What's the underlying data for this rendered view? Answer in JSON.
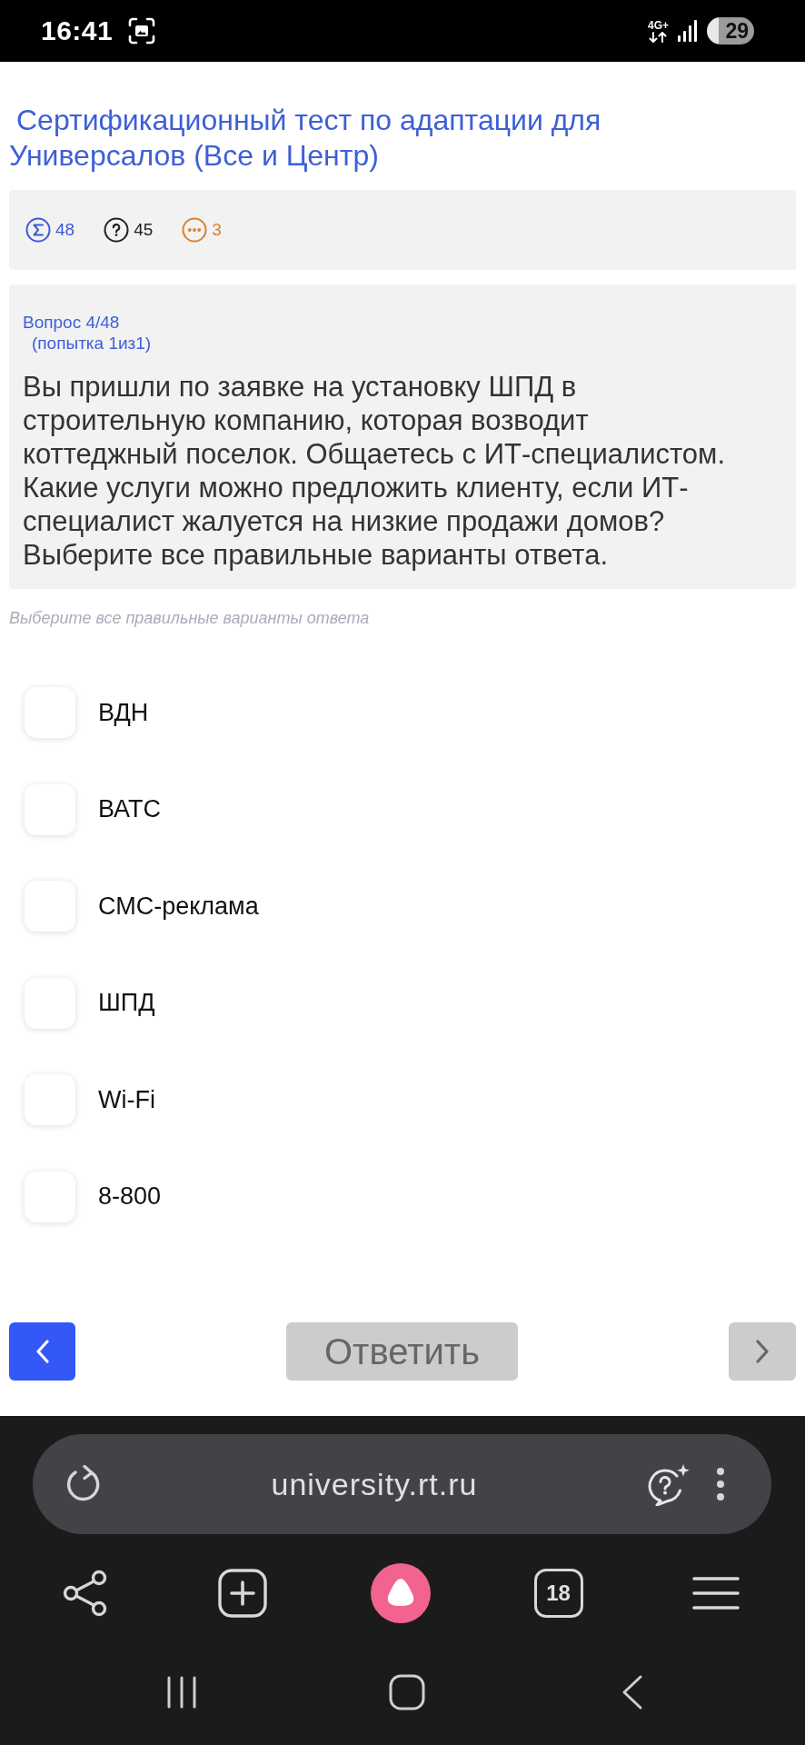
{
  "status_bar": {
    "time": "16:41",
    "network": "4G+",
    "battery": "29"
  },
  "title": "Сертификационный тест по адаптации для Универсалов (Все и Центр)",
  "stats": [
    {
      "kind": "sigma",
      "value": "48",
      "color": "#3b5bdb"
    },
    {
      "kind": "question",
      "value": "45",
      "color": "#222222"
    },
    {
      "kind": "dots",
      "value": "3",
      "color": "#d9822b"
    }
  ],
  "question": {
    "number": "Вопрос 4/48",
    "attempt": "(попытка 1из1)",
    "text": "Вы пришли по заявке на установку ШПД в строительную компанию, которая возводит коттеджный поселок. Общаетесь с ИТ-специалистом. Какие услуги можно предложить клиенту, если ИТ-специалист жалуется на низкие продажи домов? Выберите все правильные варианты ответа."
  },
  "hint": "Выберите все правильные варианты ответа",
  "options": [
    {
      "label": "ВДН",
      "checked": false
    },
    {
      "label": "ВАТС",
      "checked": false
    },
    {
      "label": "СМС-реклама",
      "checked": false
    },
    {
      "label": "ШПД",
      "checked": false
    },
    {
      "label": "Wi-Fi",
      "checked": false
    },
    {
      "label": "8-800",
      "checked": false
    }
  ],
  "navigation": {
    "back": {
      "disabled": false
    },
    "submit": {
      "label": "Ответить",
      "disabled": true
    },
    "next": {
      "disabled": true
    }
  },
  "browser": {
    "url": "university.rt.ru",
    "tab_count": "18"
  }
}
